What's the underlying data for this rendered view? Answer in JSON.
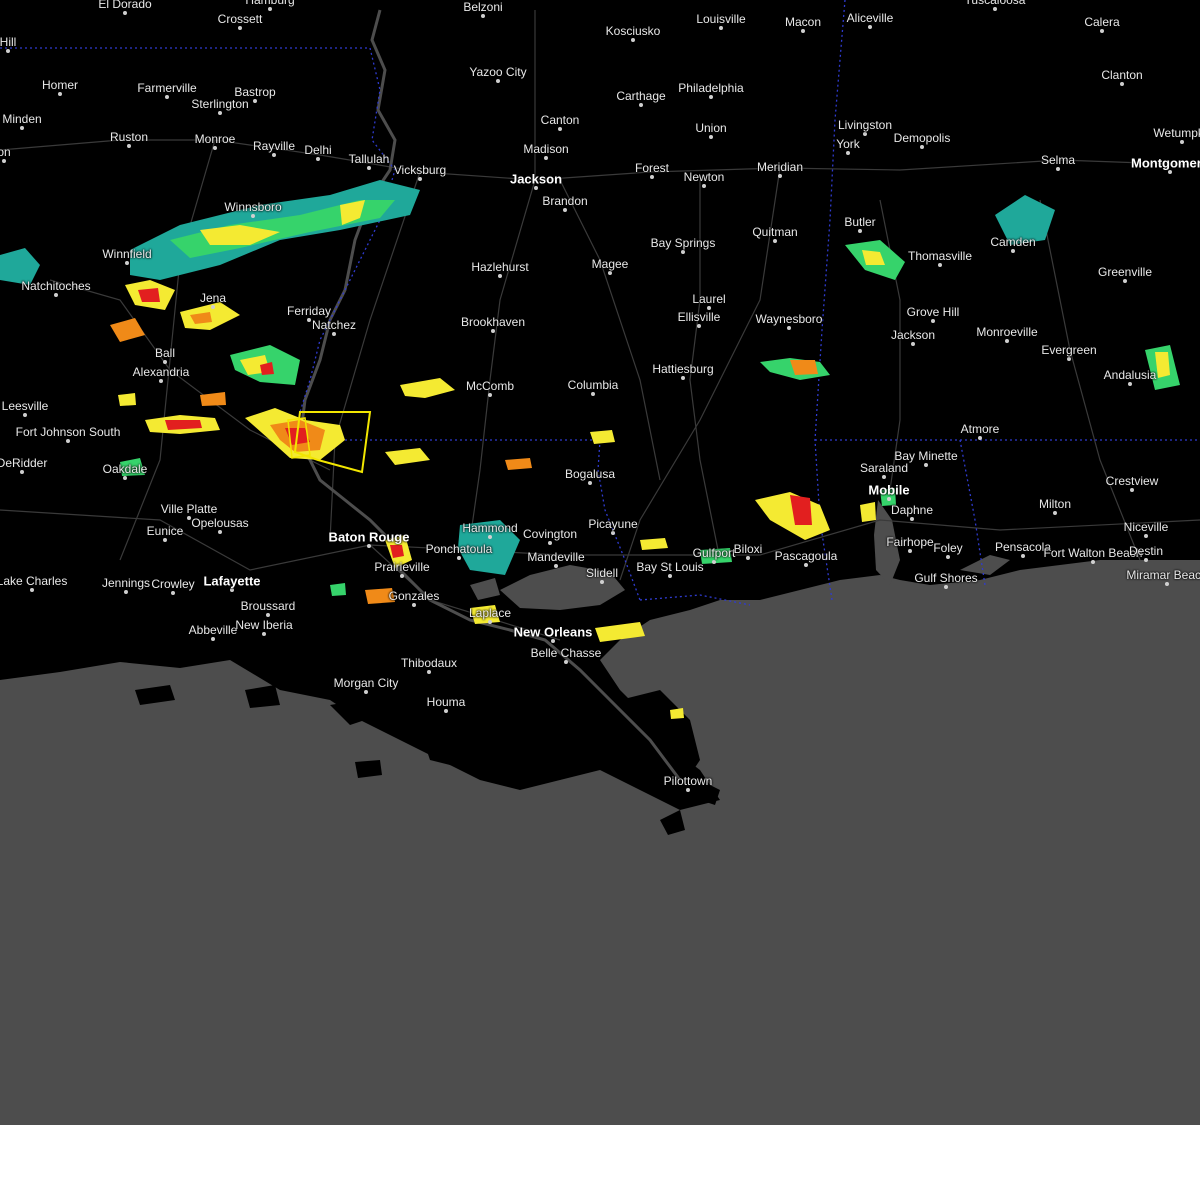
{
  "map": {
    "colors": {
      "land": "#000000",
      "water": "#4d4d4d",
      "roads": "#3a3a3a",
      "state_border": "#2f3bd0",
      "warning_polygon": "#f2e600",
      "radar_light": "#1fa89a",
      "radar_mid": "#36d36b",
      "radar_moderate": "#f4ea32",
      "radar_heavy": "#f08a18",
      "radar_intense": "#e21f1f"
    },
    "cities": [
      {
        "name": "El Dorado",
        "class": "med"
      },
      {
        "name": "Hamburg",
        "class": "med"
      },
      {
        "name": "Crossett",
        "class": "med"
      },
      {
        "name": "Belzoni",
        "class": "med"
      },
      {
        "name": "Kosciusko",
        "class": "med"
      },
      {
        "name": "Louisville",
        "class": "med"
      },
      {
        "name": "Macon",
        "class": "med"
      },
      {
        "name": "Aliceville",
        "class": "med"
      },
      {
        "name": "Tuscaloosa",
        "class": "med"
      },
      {
        "name": "Calera",
        "class": "med"
      },
      {
        "name": "Hill",
        "class": "med"
      },
      {
        "name": "Yazoo City",
        "class": "med"
      },
      {
        "name": "Homer",
        "class": "med"
      },
      {
        "name": "Farmerville",
        "class": "med"
      },
      {
        "name": "Bastrop",
        "class": "med"
      },
      {
        "name": "Sterlington",
        "class": "med"
      },
      {
        "name": "Philadelphia",
        "class": "med"
      },
      {
        "name": "Carthage",
        "class": "med"
      },
      {
        "name": "Clanton",
        "class": "med"
      },
      {
        "name": "Minden",
        "class": "med"
      },
      {
        "name": "Canton",
        "class": "med"
      },
      {
        "name": "Union",
        "class": "med"
      },
      {
        "name": "Livingston",
        "class": "med"
      },
      {
        "name": "Ruston",
        "class": "med"
      },
      {
        "name": "Monroe",
        "class": "med"
      },
      {
        "name": "Rayville",
        "class": "med"
      },
      {
        "name": "Delhi",
        "class": "med"
      },
      {
        "name": "Madison",
        "class": "med"
      },
      {
        "name": "York",
        "class": "med"
      },
      {
        "name": "Demopolis",
        "class": "med"
      },
      {
        "name": "Wetumpka",
        "class": "med"
      },
      {
        "name": "Tallulah",
        "class": "med"
      },
      {
        "name": "Vicksburg",
        "class": "med"
      },
      {
        "name": "Jackson",
        "class": "big"
      },
      {
        "name": "Forest",
        "class": "med"
      },
      {
        "name": "Newton",
        "class": "med"
      },
      {
        "name": "Meridian",
        "class": "med"
      },
      {
        "name": "Selma",
        "class": "med"
      },
      {
        "name": "Montgomery",
        "class": "big"
      },
      {
        "name": "on",
        "class": "med"
      },
      {
        "name": "Brandon",
        "class": "med"
      },
      {
        "name": "Winnsboro",
        "class": "med"
      },
      {
        "name": "Butler",
        "class": "med"
      },
      {
        "name": "Camden",
        "class": "med"
      },
      {
        "name": "Bay Springs",
        "class": "med"
      },
      {
        "name": "Quitman",
        "class": "med"
      },
      {
        "name": "Thomasville",
        "class": "med"
      },
      {
        "name": "Natchitoches",
        "class": "med"
      },
      {
        "name": "Winnfield",
        "class": "med"
      },
      {
        "name": "Hazlehurst",
        "class": "med"
      },
      {
        "name": "Magee",
        "class": "med"
      },
      {
        "name": "Greenville",
        "class": "med"
      },
      {
        "name": "Jena",
        "class": "med"
      },
      {
        "name": "Laurel",
        "class": "med"
      },
      {
        "name": "Ellisville",
        "class": "med"
      },
      {
        "name": "Ferriday",
        "class": "med"
      },
      {
        "name": "Natchez",
        "class": "med"
      },
      {
        "name": "Brookhaven",
        "class": "med"
      },
      {
        "name": "Waynesboro",
        "class": "med"
      },
      {
        "name": "Grove Hill",
        "class": "med"
      },
      {
        "name": "Monroeville",
        "class": "med"
      },
      {
        "name": "Jackson",
        "class": "med"
      },
      {
        "name": "Ball",
        "class": "med"
      },
      {
        "name": "Evergreen",
        "class": "med"
      },
      {
        "name": "Alexandria",
        "class": "med"
      },
      {
        "name": "Hattiesburg",
        "class": "med"
      },
      {
        "name": "Andalusia",
        "class": "med"
      },
      {
        "name": "McComb",
        "class": "med"
      },
      {
        "name": "Columbia",
        "class": "med"
      },
      {
        "name": "Leesville",
        "class": "med"
      },
      {
        "name": "Fort Johnson South",
        "class": "med"
      },
      {
        "name": "Atmore",
        "class": "med"
      },
      {
        "name": "Bay Minette",
        "class": "med"
      },
      {
        "name": "DeRidder",
        "class": "med"
      },
      {
        "name": "Oakdale",
        "class": "med"
      },
      {
        "name": "Bogalusa",
        "class": "med"
      },
      {
        "name": "Saraland",
        "class": "med"
      },
      {
        "name": "Crestview",
        "class": "med"
      },
      {
        "name": "Mobile",
        "class": "big"
      },
      {
        "name": "Ville Platte",
        "class": "med"
      },
      {
        "name": "Milton",
        "class": "med"
      },
      {
        "name": "Daphne",
        "class": "med"
      },
      {
        "name": "Opelousas",
        "class": "med"
      },
      {
        "name": "Hammond",
        "class": "med"
      },
      {
        "name": "Picayune",
        "class": "med"
      },
      {
        "name": "Niceville",
        "class": "med"
      },
      {
        "name": "Eunice",
        "class": "med"
      },
      {
        "name": "Baton Rouge",
        "class": "big"
      },
      {
        "name": "Covington",
        "class": "med"
      },
      {
        "name": "Fairhope",
        "class": "med"
      },
      {
        "name": "Gulfport",
        "class": "med"
      },
      {
        "name": "Biloxi",
        "class": "med"
      },
      {
        "name": "Ponchatoula",
        "class": "med"
      },
      {
        "name": "Foley",
        "class": "med"
      },
      {
        "name": "Pensacola",
        "class": "med"
      },
      {
        "name": "Fort Walton Beach",
        "class": "med"
      },
      {
        "name": "Destin",
        "class": "med"
      },
      {
        "name": "Mandeville",
        "class": "med"
      },
      {
        "name": "Bay St Louis",
        "class": "med"
      },
      {
        "name": "Pascagoula",
        "class": "med"
      },
      {
        "name": "Prairieville",
        "class": "med"
      },
      {
        "name": "Miramar Beach",
        "class": "med"
      },
      {
        "name": "Slidell",
        "class": "med"
      },
      {
        "name": "Gulf Shores",
        "class": "med"
      },
      {
        "name": "Lake Charles",
        "class": "med"
      },
      {
        "name": "Jennings",
        "class": "med"
      },
      {
        "name": "Crowley",
        "class": "med"
      },
      {
        "name": "Lafayette",
        "class": "big"
      },
      {
        "name": "Gonzales",
        "class": "med"
      },
      {
        "name": "Broussard",
        "class": "med"
      },
      {
        "name": "Laplace",
        "class": "med"
      },
      {
        "name": "New Orleans",
        "class": "big"
      },
      {
        "name": "Abbeville",
        "class": "med"
      },
      {
        "name": "New Iberia",
        "class": "med"
      },
      {
        "name": "Belle Chasse",
        "class": "med"
      },
      {
        "name": "Thibodaux",
        "class": "med"
      },
      {
        "name": "Morgan City",
        "class": "med"
      },
      {
        "name": "Houma",
        "class": "med"
      },
      {
        "name": "Pilottown",
        "class": "med"
      }
    ]
  }
}
